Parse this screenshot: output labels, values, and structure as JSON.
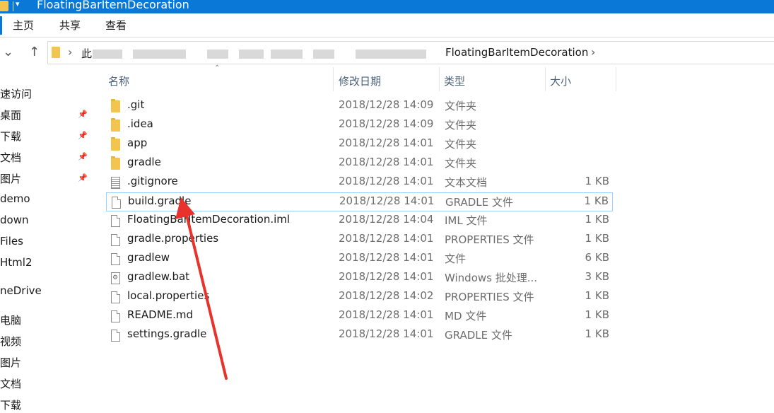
{
  "window": {
    "title": "FloatingBarItemDecoration"
  },
  "ribbon": {
    "tabs": [
      "主页",
      "共享",
      "查看"
    ]
  },
  "address": {
    "root": "此",
    "current_folder": "FloatingBarItemDecoration"
  },
  "sidebar": {
    "items": [
      {
        "label": "速访问",
        "pinned": false
      },
      {
        "label": "桌面",
        "pinned": true
      },
      {
        "label": "下载",
        "pinned": true
      },
      {
        "label": "文档",
        "pinned": true
      },
      {
        "label": "图片",
        "pinned": true
      },
      {
        "label": "demo",
        "pinned": false
      },
      {
        "label": "down",
        "pinned": false
      },
      {
        "label": "Files",
        "pinned": false
      },
      {
        "label": "Html2",
        "pinned": false
      },
      {
        "label": "neDrive",
        "pinned": false
      },
      {
        "label": "电脑",
        "pinned": false
      },
      {
        "label": "视频",
        "pinned": false
      },
      {
        "label": "图片",
        "pinned": false
      },
      {
        "label": "文档",
        "pinned": false
      },
      {
        "label": "下载",
        "pinned": false
      }
    ]
  },
  "columns": {
    "name": "名称",
    "modified": "修改日期",
    "type": "类型",
    "size": "大小"
  },
  "files": [
    {
      "name": ".git",
      "modified": "2018/12/28 14:09",
      "type": "文件夹",
      "size": "",
      "icon": "folder-icon"
    },
    {
      "name": ".idea",
      "modified": "2018/12/28 14:09",
      "type": "文件夹",
      "size": "",
      "icon": "folder-icon"
    },
    {
      "name": "app",
      "modified": "2018/12/28 14:01",
      "type": "文件夹",
      "size": "",
      "icon": "folder-icon"
    },
    {
      "name": "gradle",
      "modified": "2018/12/28 14:01",
      "type": "文件夹",
      "size": "",
      "icon": "folder-icon"
    },
    {
      "name": ".gitignore",
      "modified": "2018/12/28 14:01",
      "type": "文本文档",
      "size": "1 KB",
      "icon": "text-file-icon"
    },
    {
      "name": "build.gradle",
      "modified": "2018/12/28 14:01",
      "type": "GRADLE 文件",
      "size": "1 KB",
      "icon": "file-icon",
      "selected": true
    },
    {
      "name": "FloatingBarItemDecoration.iml",
      "modified": "2018/12/28 14:04",
      "type": "IML 文件",
      "size": "1 KB",
      "icon": "file-icon"
    },
    {
      "name": "gradle.properties",
      "modified": "2018/12/28 14:01",
      "type": "PROPERTIES 文件",
      "size": "1 KB",
      "icon": "file-icon"
    },
    {
      "name": "gradlew",
      "modified": "2018/12/28 14:01",
      "type": "文件",
      "size": "6 KB",
      "icon": "file-icon"
    },
    {
      "name": "gradlew.bat",
      "modified": "2018/12/28 14:01",
      "type": "Windows 批处理...",
      "size": "3 KB",
      "icon": "batch-file-icon"
    },
    {
      "name": "local.properties",
      "modified": "2018/12/28 14:02",
      "type": "PROPERTIES 文件",
      "size": "1 KB",
      "icon": "file-icon"
    },
    {
      "name": "README.md",
      "modified": "2018/12/28 14:01",
      "type": "MD 文件",
      "size": "1 KB",
      "icon": "file-icon"
    },
    {
      "name": "settings.gradle",
      "modified": "2018/12/28 14:01",
      "type": "GRADLE 文件",
      "size": "1 KB",
      "icon": "file-icon"
    }
  ],
  "colors": {
    "titlebar": "#0a78d7",
    "selection_border": "#99d1ff",
    "annotation_arrow": "#e8322b",
    "folder": "#f3c54e"
  }
}
